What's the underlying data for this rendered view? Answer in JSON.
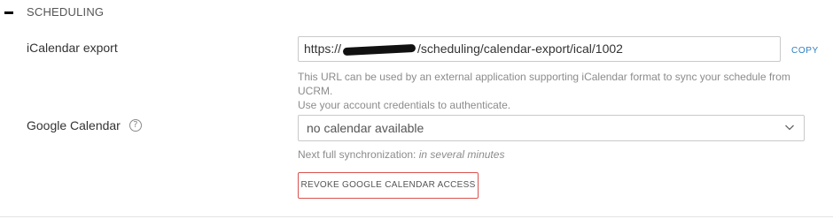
{
  "section": {
    "title": "SCHEDULING",
    "collapse_icon": "minus-icon"
  },
  "ical_export": {
    "label": "iCalendar export",
    "url_prefix": "https://",
    "url_suffix": "/scheduling/calendar-export/ical/1002",
    "copy_label": "COPY",
    "help_line_1": "This URL can be used by an external application supporting iCalendar format to sync your schedule from UCRM.",
    "help_line_2": "Use your account credentials to authenticate."
  },
  "google_calendar": {
    "label": "Google Calendar",
    "help_icon": "question-circle-icon",
    "help_icon_glyph": "?",
    "select_value": "no calendar available",
    "sync_prefix": "Next full synchronization: ",
    "sync_value": "in several minutes",
    "revoke_label": "REVOKE GOOGLE CALENDAR ACCESS"
  },
  "colors": {
    "link": "#2f7fc1",
    "danger_border": "#d9534f",
    "muted_text": "#8c8c8c"
  }
}
